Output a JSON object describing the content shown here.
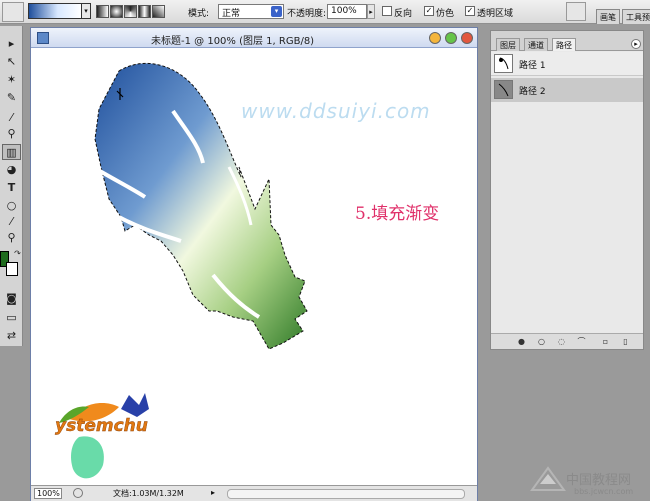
{
  "options_bar": {
    "mode_label": "模式:",
    "mode_value": "正常",
    "opacity_label": "不透明度:",
    "opacity_value": "100%",
    "reverse_label": "反向",
    "dither_label": "仿色",
    "transparency_label": "透明区域",
    "dock_tab_brushes": "画笔",
    "dock_tab_tool_presets": "工具预"
  },
  "document": {
    "title": "未标题-1 @ 100% (图层 1, RGB/8)",
    "watermark": "www.ddsuiyi.com",
    "step_text": "5.填充渐变",
    "logo_text": "ystemchu",
    "zoom": "100%",
    "status": "文档:1.03M/1.32M"
  },
  "panel": {
    "tabs": [
      "图层",
      "通道",
      "路径"
    ],
    "paths": [
      "路径 1",
      "路径 2"
    ]
  },
  "site": {
    "name": "中国教程网",
    "url": "bbs.jcwcn.com"
  },
  "colors": {
    "foreground": "#1f6b1e",
    "background": "#ffffff",
    "gradient_start": "#1f4f9c",
    "gradient_mid": "#eaf6d8",
    "gradient_end": "#2f7a27",
    "step_text": "#e0306a"
  }
}
